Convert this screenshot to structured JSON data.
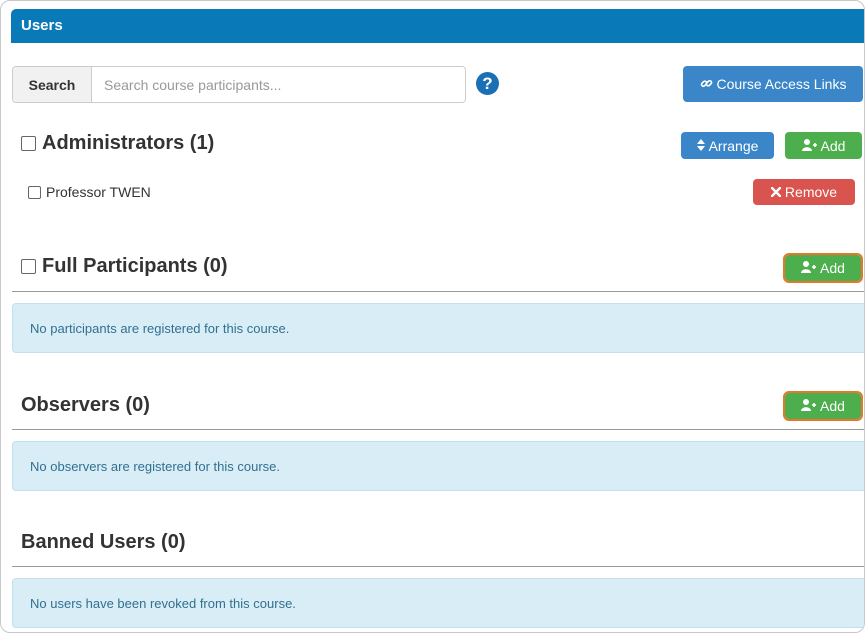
{
  "header": {
    "title": "Users"
  },
  "search": {
    "label": "Search",
    "placeholder": "Search course participants..."
  },
  "help": {
    "glyph": "?"
  },
  "course_access_links": {
    "label": "Course Access Links"
  },
  "administrators": {
    "title": "Administrators (1)",
    "arrange_label": "Arrange",
    "add_label": "Add",
    "members": [
      {
        "name": "Professor TWEN",
        "remove_label": "Remove"
      }
    ]
  },
  "full_participants": {
    "title": "Full Participants (0)",
    "add_label": "Add",
    "empty_message": "No participants are registered for this course."
  },
  "observers": {
    "title": "Observers (0)",
    "add_label": "Add",
    "empty_message": "No observers are registered for this course."
  },
  "banned_users": {
    "title": "Banned Users (0)",
    "empty_message": "No users have been revoked from this course."
  },
  "colors": {
    "header_blue": "#0a79b8",
    "primary_blue": "#3a86c8",
    "success_green": "#4cae4c",
    "danger_red": "#d9534f",
    "info_bg": "#d9edf7",
    "highlight_orange": "#e8772a"
  },
  "icons": {
    "link": "link-icon",
    "sort": "sort-icon",
    "user_add": "user-add-icon",
    "remove": "remove-icon",
    "help": "question-circle-icon"
  }
}
